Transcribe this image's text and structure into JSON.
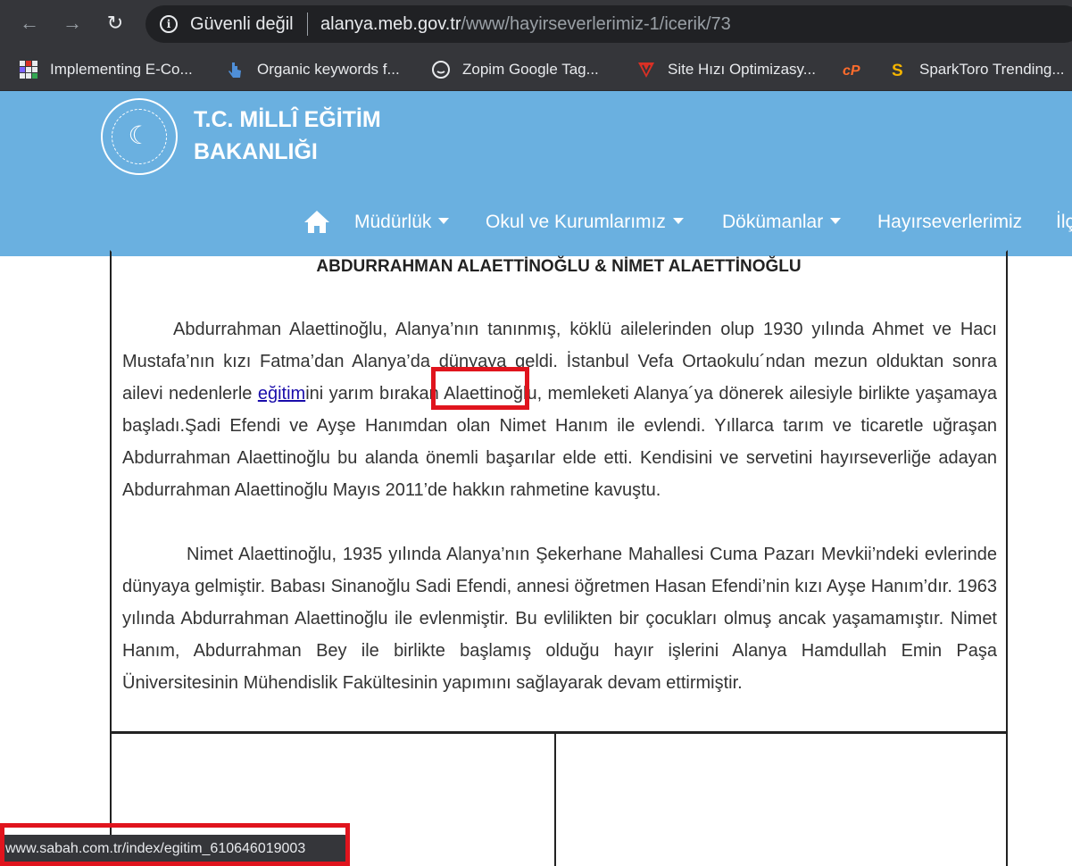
{
  "browser": {
    "security_label": "Güvenli değil",
    "url_host": "alanya.meb.gov.tr",
    "url_path": "/www/hayirseverlerimiz-1/icerik/73",
    "bookmarks": [
      {
        "label": "Implementing E-Co...",
        "icon": "grid-app-icon"
      },
      {
        "label": "Organic keywords f...",
        "icon": "pointer-icon"
      },
      {
        "label": "Zopim Google Tag...",
        "icon": "chat-icon"
      },
      {
        "label": "Site Hızı Optimizasy...",
        "icon": "shield-v-icon"
      },
      {
        "label": "",
        "icon": "cpanel-icon"
      },
      {
        "label": "SparkToro Trending...",
        "icon": "sparktoro-icon"
      }
    ]
  },
  "site": {
    "ministry_title": "T.C. MİLLÎ EĞİTİM BAKANLIĞI",
    "nav": [
      {
        "label": "Müdürlük",
        "dropdown": true
      },
      {
        "label": "Okul ve Kurumlarımız",
        "dropdown": true
      },
      {
        "label": "Dökümanlar",
        "dropdown": true
      },
      {
        "label": "Hayırseverlerimiz",
        "dropdown": false
      },
      {
        "label": "İlç",
        "dropdown": false
      }
    ]
  },
  "article": {
    "title": "ABDURRAHMAN ALAETTİNOĞLU & NİMET ALAETTİNOĞLU",
    "p1_before": "Abdurrahman Alaettinoğlu, Alanya’nın tanınmış, köklü ailelerinden olup  1930 yılında Ahmet ve Hacı Mustafa’nın kızı Fatma’dan Alanya’da dünyaya geldi. İstanbul Vefa Ortaokulu´ndan mezun olduktan sonra ailevi nedenlerle ",
    "p1_link": "eğitim",
    "p1_after": "ini yarım bırakan Alaettinoğlu, memleketi Alanya´ya dönerek ailesiyle birlikte yaşamaya başladı.Şadi Efendi ve Ayşe Hanımdan olan Nimet Hanım ile evlendi. Yıllarca tarım ve ticaretle uğraşan Abdurrahman Alaettinoğlu bu alanda önemli başarılar elde etti. Kendisini ve servetini hayırseverliğe adayan Abdurrahman Alaettinoğlu Mayıs 2011’de hakkın rahmetine kavuştu.",
    "p2": "Nimet Alaettinoğlu, 1935 yılında Alanya’nın Şekerhane Mahallesi Cuma Pazarı Mevkii’ndeki evlerinde dünyaya gelmiştir. Babası Sinanoğlu Sadi Efendi, annesi öğretmen Hasan Efendi’nin kızı Ayşe Hanım’dır. 1963 yılında Abdurrahman Alaettinoğlu ile evlenmiştir. Bu evlilikten bir çocukları olmuş ancak yaşamamıştır. Nimet Hanım, Abdurrahman Bey ile birlikte başlamış olduğu hayır işlerini Alanya Hamdullah Emin Paşa Üniversitesinin Mühendislik Fakültesinin yapımını sağlayarak devam ettirmiştir."
  },
  "status_bar": {
    "url": "www.sabah.com.tr/index/egitim_610646019003"
  },
  "colors": {
    "header_blue": "#6ab0e0",
    "highlight_red": "#e0141d",
    "chrome_dark": "#35363a"
  }
}
